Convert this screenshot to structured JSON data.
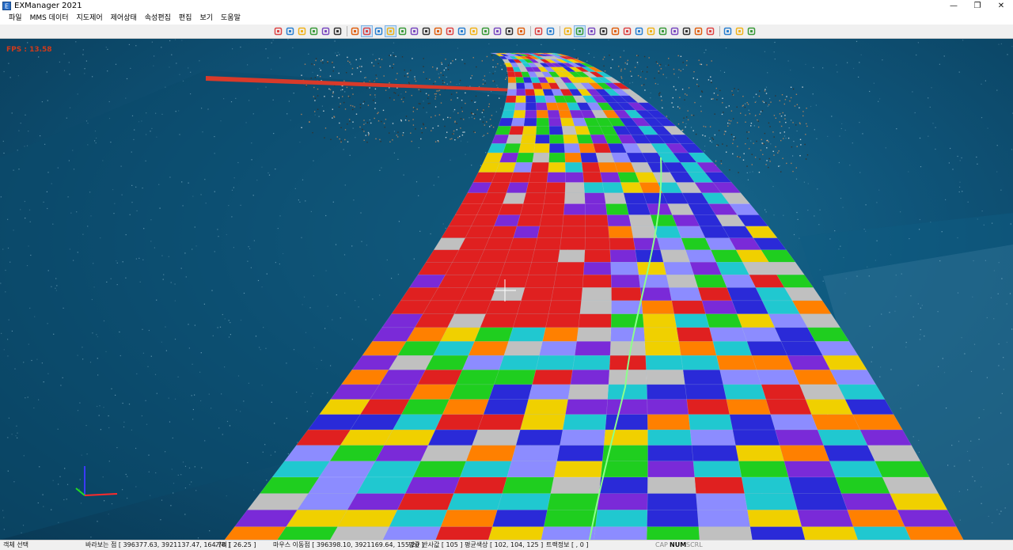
{
  "window": {
    "title": "EXManager 2021",
    "controls": {
      "minimize": "—",
      "restore": "❐",
      "close": "✕"
    }
  },
  "menu": [
    "파일",
    "MMS 데이터",
    "지도제어",
    "제어상태",
    "속성편집",
    "편집",
    "보기",
    "도움말"
  ],
  "toolbar": {
    "groups": [
      [
        "new-file-icon",
        "open-folder-icon",
        "save-icon",
        "cube-icon",
        "sphere-icon",
        "pin-icon"
      ],
      [
        "red-book-icon",
        "layout-a-icon",
        "layout-b-icon",
        "layout-c-icon",
        "grid-red-icon",
        "gear-icon",
        "undo-icon",
        "redo-icon",
        "columns-icon",
        "scissors-icon",
        "copy-icon",
        "paste-icon",
        "circle-icon",
        "help-icon",
        "pan-small-icon"
      ],
      [
        "zoom-icon",
        "rectangle-icon"
      ],
      [
        "hand-icon",
        "select-arrow-icon",
        "select-box-icon",
        "line-red-icon",
        "house-icon",
        "steps-icon",
        "triangle-yellow-icon",
        "car-icon",
        "marker-red-icon",
        "shape-a-icon",
        "shape-b-icon",
        "flag-icon",
        "triangle-red-icon"
      ],
      [
        "square-icon",
        "diagonal-icon",
        "lock-icon"
      ]
    ]
  },
  "viewport": {
    "fps": "FPS : 13.58"
  },
  "status": {
    "mode": "객체 선택",
    "view_point": "바라보는 점 [ 396377.63, 3921137.47, 164.78 ]",
    "distance": "거리 [ 26.25 ]",
    "mouse_point": "마우스 이동점 [ 396398.10, 3921169.64, 155.20 ]",
    "avg_reflect": "평균 반사값 [ 105 ]",
    "avg_color": "평균색상 [ 102, 104, 125 ]",
    "track_info": "트랙정보 [ , 0 ]",
    "cap": "CAP",
    "num": "NUM",
    "scrl": "SCRL"
  }
}
